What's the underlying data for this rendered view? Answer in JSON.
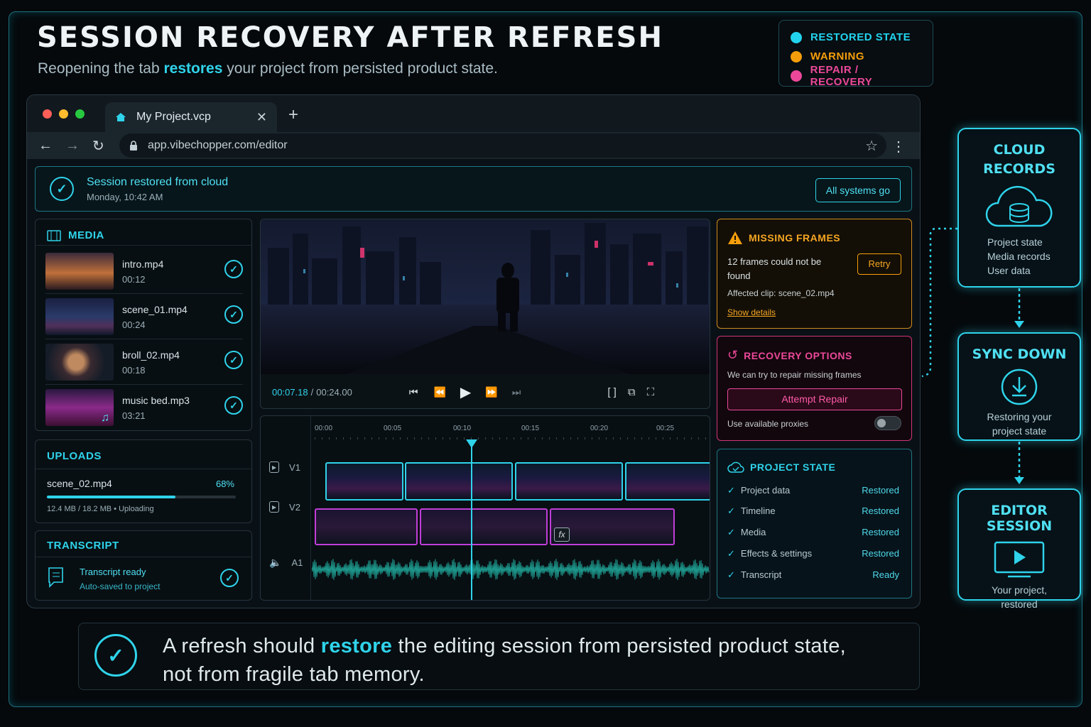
{
  "header": {
    "title": "SESSION RECOVERY AFTER REFRESH",
    "subtitle_pre": "Reopening the tab",
    "subtitle_highlight": "restores",
    "subtitle_post": "your project from persisted product state."
  },
  "legend": [
    {
      "label": "RESTORED STATE",
      "color": "#22d3ee"
    },
    {
      "label": "WARNING",
      "color": "#f59e0b"
    },
    {
      "label": "REPAIR / RECOVERY",
      "color": "#ec4899"
    }
  ],
  "browser": {
    "tab_title": "My Project.vcp",
    "new_tab": "+",
    "url": "app.vibechopper.com/editor"
  },
  "banner": {
    "title": "Session restored from cloud",
    "time": "Monday, 10:42 AM",
    "status_button": "All systems go"
  },
  "media": {
    "title": "MEDIA",
    "items": [
      {
        "name": "intro.mp4",
        "duration": "00:12"
      },
      {
        "name": "scene_01.mp4",
        "duration": "00:24"
      },
      {
        "name": "broll_02.mp4",
        "duration": "00:18"
      },
      {
        "name": "music bed.mp3",
        "duration": "03:21"
      }
    ]
  },
  "uploads": {
    "title": "UPLOADS",
    "file": "scene_02.mp4",
    "percent_label": "68%",
    "progress": 0.68,
    "detail": "12.4 MB / 18.2 MB  •  Uploading"
  },
  "transcript": {
    "title": "TRANSCRIPT",
    "status": "Transcript ready",
    "detail": "Auto-saved to project"
  },
  "player": {
    "current": "00:07.18",
    "sep": "/",
    "total": "00:24.00"
  },
  "timeline": {
    "ticks": [
      "00:00",
      "00:05",
      "00:10",
      "00:15",
      "00:20",
      "00:25"
    ],
    "tracks": [
      "V1",
      "V2",
      "A1"
    ],
    "fx_label": "fx"
  },
  "missing": {
    "title": "MISSING FRAMES",
    "message": "12 frames could not be found",
    "retry": "Retry",
    "affected": "Affected clip: scene_02.mp4",
    "details_link": "Show details"
  },
  "recovery": {
    "title": "RECOVERY OPTIONS",
    "message": "We can try to repair missing frames",
    "button": "Attempt Repair",
    "toggle_label": "Use available proxies"
  },
  "project_state": {
    "title": "PROJECT STATE",
    "rows": [
      {
        "label": "Project data",
        "status": "Restored"
      },
      {
        "label": "Timeline",
        "status": "Restored"
      },
      {
        "label": "Media",
        "status": "Restored"
      },
      {
        "label": "Effects & settings",
        "status": "Restored"
      },
      {
        "label": "Transcript",
        "status": "Ready"
      }
    ]
  },
  "flow": [
    {
      "title_1": "CLOUD",
      "title_2": "RECORDS",
      "lines": [
        "Project state",
        "Media records",
        "User data"
      ],
      "icon": "cloud-database-icon"
    },
    {
      "title_1": "SYNC DOWN",
      "lines": [
        "Restoring your",
        "project state"
      ],
      "icon": "download-icon"
    },
    {
      "title_1": "EDITOR SESSION",
      "lines": [
        "Your project,",
        "restored"
      ],
      "icon": "play-screen-icon"
    }
  ],
  "footer": {
    "pre": "A refresh should",
    "highlight": "restore",
    "post": "the editing session from persisted product state,",
    "line2": "not from fragile tab memory."
  }
}
